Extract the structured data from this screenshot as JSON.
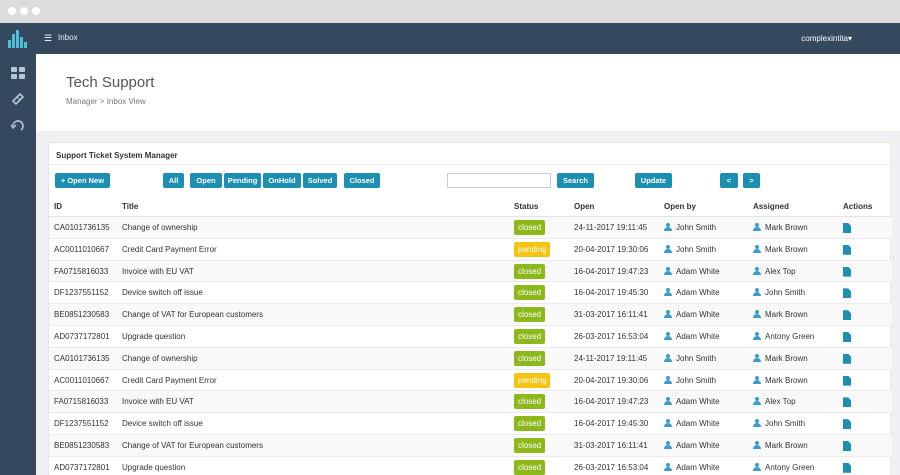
{
  "header": {
    "menu_icon": "hamburger-icon",
    "title": "Inbox",
    "user": "complexintita",
    "user_caret": "▾"
  },
  "page": {
    "title": "Tech Support",
    "breadcrumb": "Manager > Inbox View"
  },
  "panel": {
    "title": "Support Ticket System Manager"
  },
  "toolbar": {
    "open_new": "+ Open New",
    "all": "All",
    "open": "Open",
    "pending": "Pending",
    "onhold": "OnHold",
    "solved": "Solved",
    "closed": "Closed",
    "search_value": "",
    "search": "Search",
    "update": "Update",
    "prev": "<",
    "next": ">"
  },
  "table": {
    "columns": {
      "id": "ID",
      "title": "Title",
      "status": "Status",
      "open": "Open",
      "open_by": "Open by",
      "assigned": "Assigned",
      "actions": "Actions"
    },
    "rows": [
      {
        "id": "CA0101736135",
        "title": "Change of ownership",
        "status": "closed",
        "open": "24-11-2017 19:11:45",
        "open_by": "John Smith",
        "assigned": "Mark Brown"
      },
      {
        "id": "AC0011010667",
        "title": "Credit Card Payment Error",
        "status": "pending",
        "open": "20-04-2017 19:30:06",
        "open_by": "John Smith",
        "assigned": "Mark Brown"
      },
      {
        "id": "FA0715816033",
        "title": "Invoice with EU VAT",
        "status": "closed",
        "open": "16-04-2017 19:47:23",
        "open_by": "Adam White",
        "assigned": "Alex Top"
      },
      {
        "id": "DF1237551152",
        "title": "Device switch off issue",
        "status": "closed",
        "open": "16-04-2017 19:45:30",
        "open_by": "Adam White",
        "assigned": "John Smith"
      },
      {
        "id": "BE0851230583",
        "title": "Change of VAT for European customers",
        "status": "closed",
        "open": "31-03-2017 16:11:41",
        "open_by": "Adam White",
        "assigned": "Mark Brown"
      },
      {
        "id": "AD0737172801",
        "title": "Upgrade question",
        "status": "closed",
        "open": "26-03-2017 16:53:04",
        "open_by": "Adam White",
        "assigned": "Antony Green"
      },
      {
        "id": "CA0101736135",
        "title": "Change of ownership",
        "status": "closed",
        "open": "24-11-2017 19:11:45",
        "open_by": "John Smith",
        "assigned": "Mark Brown"
      },
      {
        "id": "AC0011010667",
        "title": "Credit Card Payment Error",
        "status": "pending",
        "open": "20-04-2017 19:30:06",
        "open_by": "John Smith",
        "assigned": "Mark Brown"
      },
      {
        "id": "FA0715816033",
        "title": "Invoice with EU VAT",
        "status": "closed",
        "open": "16-04-2017 19:47:23",
        "open_by": "Adam White",
        "assigned": "Alex Top"
      },
      {
        "id": "DF1237551152",
        "title": "Device switch off issue",
        "status": "closed",
        "open": "16-04-2017 19:45:30",
        "open_by": "Adam White",
        "assigned": "John Smith"
      },
      {
        "id": "BE0851230583",
        "title": "Change of VAT for European customers",
        "status": "closed",
        "open": "31-03-2017 16:11:41",
        "open_by": "Adam White",
        "assigned": "Mark Brown"
      },
      {
        "id": "AD0737172801",
        "title": "Upgrade question",
        "status": "closed",
        "open": "26-03-2017 16:53:04",
        "open_by": "Adam White",
        "assigned": "Antony Green"
      }
    ]
  },
  "colors": {
    "topbar": "#34495e",
    "button": "#1d8fb3",
    "closed": "#8db81c",
    "pending": "#f5c411",
    "person_icon": "#3a9bd1"
  }
}
